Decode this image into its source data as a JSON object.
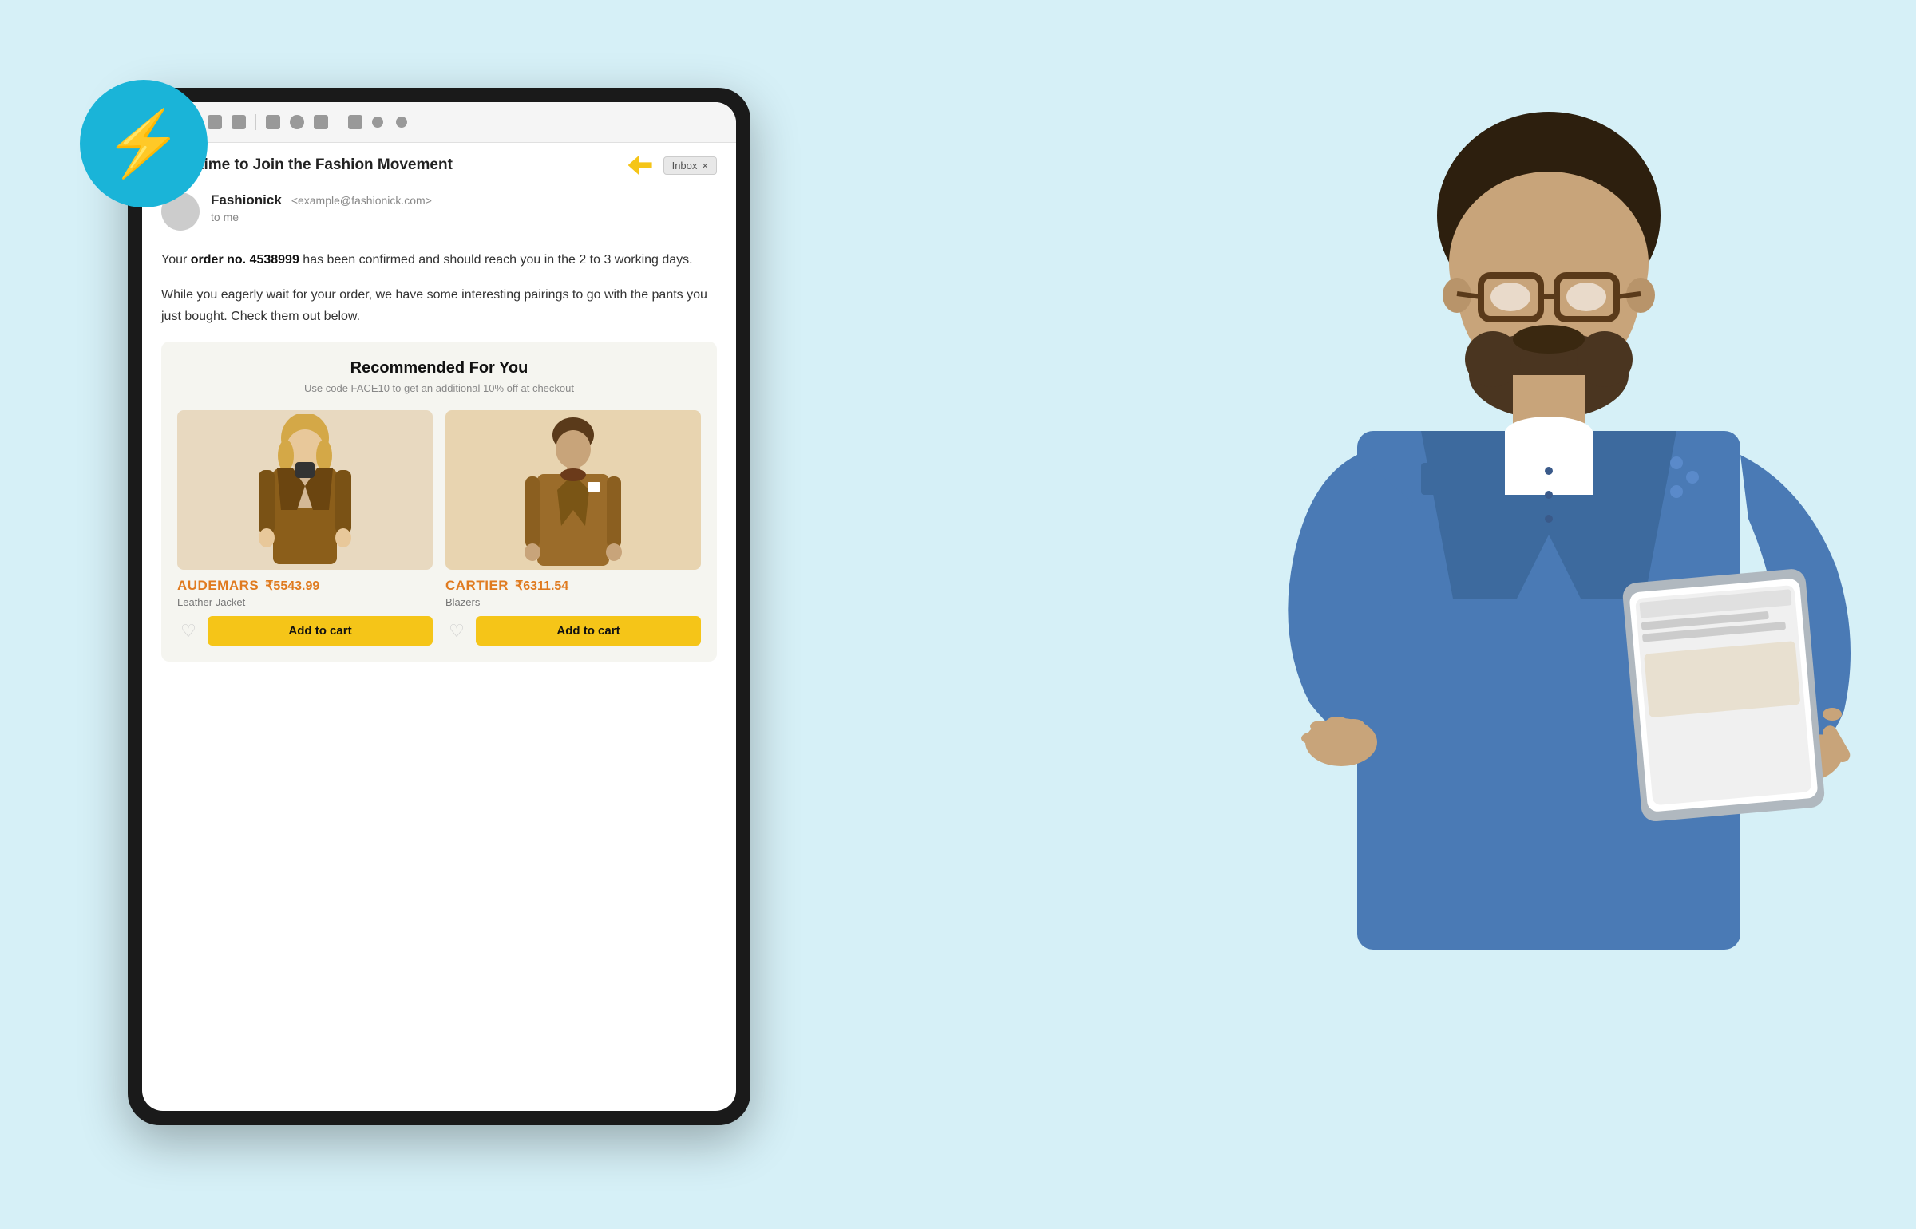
{
  "background_color": "#d6f0f7",
  "lightning_circle": {
    "color": "#1ab4d8",
    "icon": "⚡"
  },
  "tablet": {
    "device_color": "#1a1a1a",
    "screen_color": "#ffffff"
  },
  "toolbar": {
    "back_arrow": "←",
    "icons": [
      "archive",
      "info",
      "trash",
      "mail",
      "clock",
      "label",
      "separator",
      "video",
      "more"
    ]
  },
  "email": {
    "subject": "Your time to Join the Fashion Movement",
    "inbox_label": "Inbox",
    "inbox_x": "×",
    "double_arrow_color": "#f5c518",
    "sender": {
      "name": "Fashionick",
      "email": "<example@fashionick.com>",
      "to": "to me"
    },
    "body_paragraph1": "Your order no. 4538999 has been confirmed and should reach you in the 2 to 3 working days.",
    "body_paragraph1_bold": "order no. 4538999",
    "body_paragraph2": "While you eagerly wait for your order, we have some interesting pairings to go with the pants you just bought. Check them out below.",
    "recommended": {
      "title": "Recommended For You",
      "subtitle": "Use code FACE10 to get an additional 10% off at checkout",
      "products": [
        {
          "name": "AUDEMARS",
          "price": "₹5543.99",
          "category": "Leather Jacket",
          "add_to_cart": "Add to cart",
          "heart_icon": "♡"
        },
        {
          "name": "CARTIER",
          "price": "₹6311.54",
          "category": "Blazers",
          "add_to_cart": "Add to cart",
          "heart_icon": "♡"
        }
      ]
    }
  },
  "person": {
    "description": "Man with glasses and denim shirt holding a tablet"
  }
}
